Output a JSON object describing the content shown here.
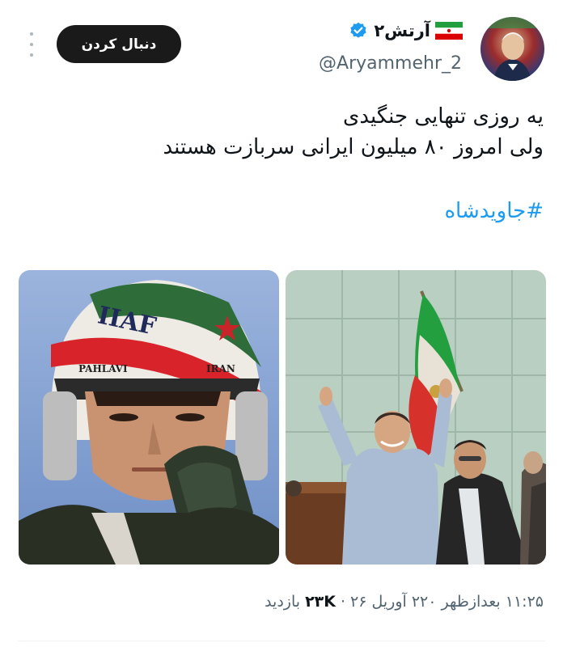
{
  "header": {
    "follow_label": "دنبال کردن",
    "display_name": "آرتش۲",
    "handle": "@Aryammehr_2",
    "avatar_icon": "profile-photo-icon",
    "verified_icon": "verified-badge-icon",
    "more_icon": "more-vertical-icon"
  },
  "tweet": {
    "lines": [
      "یه روزی تنهایی جنگیدی",
      "ولی امروز ۸۰ میلیون ایرانی سربازت هستند"
    ],
    "hashtag": "#جاویدشاه"
  },
  "media": {
    "photo_left_label": "IIAF",
    "photo_left_sub1": "PAHLAVI",
    "photo_left_sub2": "IRAN"
  },
  "meta": {
    "time": "۱۱:۲۵ بعدازظهر",
    "date": "۲۲۰ آوریل ۲۶",
    "views_count": "۲۳K",
    "views_label": "بازدید",
    "sep": "·"
  },
  "colors": {
    "accent": "#1d9bf0",
    "follow_bg": "#1a1a1a",
    "flag_green": "#239f40",
    "flag_red": "#da0000"
  }
}
